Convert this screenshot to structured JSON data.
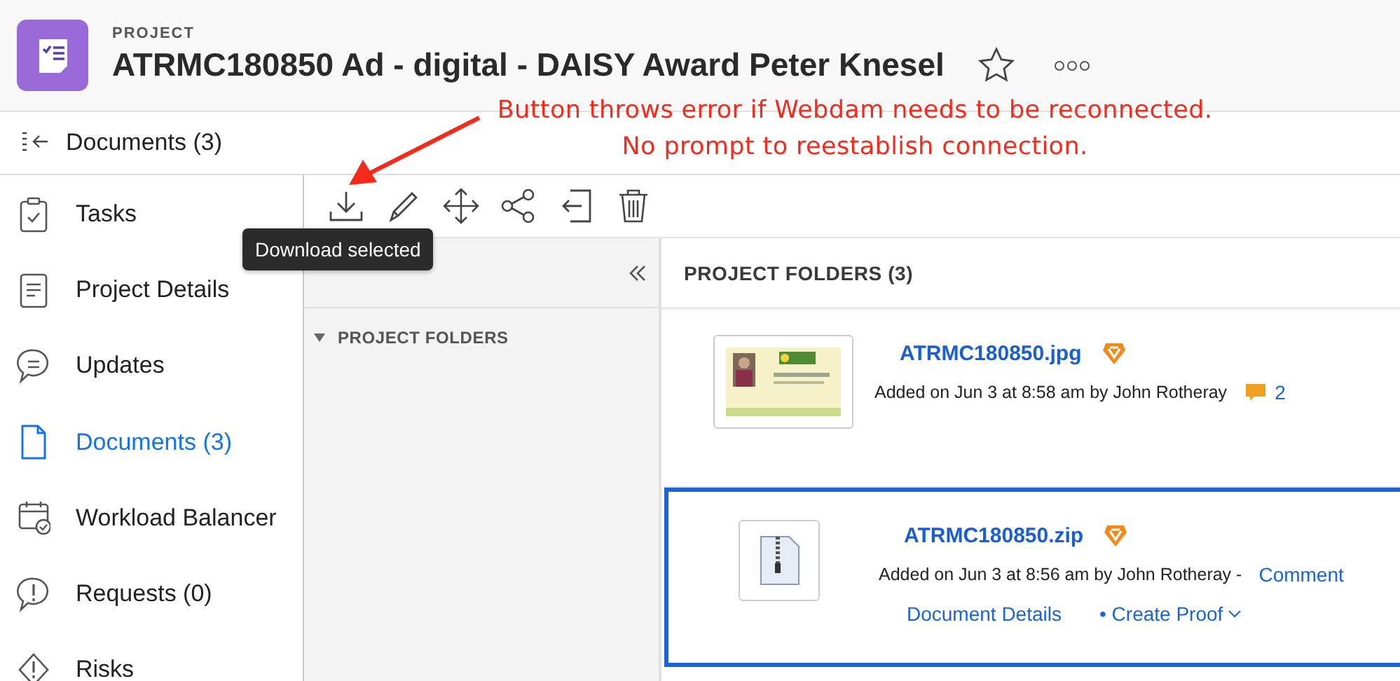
{
  "header": {
    "label": "PROJECT",
    "title": "ATRMC180850 Ad - digital - DAISY Award Peter Knesel",
    "favorite": false
  },
  "breadcrumb": {
    "label": "Documents (3)"
  },
  "sidebar": {
    "items": [
      {
        "label": "Tasks",
        "kind": "tasks",
        "selected": false
      },
      {
        "label": "Project Details",
        "kind": "details",
        "selected": false
      },
      {
        "label": "Updates",
        "kind": "updates",
        "selected": false
      },
      {
        "label": "Documents (3)",
        "kind": "documents",
        "selected": true
      },
      {
        "label": "Workload Balancer",
        "kind": "workload",
        "selected": false
      },
      {
        "label": "Requests (0)",
        "kind": "requests",
        "selected": false
      },
      {
        "label": "Risks",
        "kind": "risks",
        "selected": false
      }
    ]
  },
  "toolbar": {
    "tooltip": "Download selected"
  },
  "folders_panel": {
    "tree": [
      {
        "label": "PROJECT FOLDERS",
        "expanded": true
      }
    ]
  },
  "documents": {
    "title": "PROJECT FOLDERS (3)",
    "items": [
      {
        "name": "ATRMC180850.jpg",
        "meta": "Added on Jun 3 at 8:58 am by John Rotheray",
        "comments": "2",
        "selected": false
      },
      {
        "kind": "zip",
        "name": "ATRMC180850.zip",
        "meta": "Added on Jun 3 at 8:56 am by John Rotheray -",
        "comment_link": "Comment",
        "actions": [
          "Document Details",
          "• Create Proof"
        ],
        "selected": true
      }
    ]
  },
  "annotation": {
    "lines": [
      "Button throws error if Webdam needs to be reconnected.",
      "No prompt to reestablish connection."
    ]
  }
}
